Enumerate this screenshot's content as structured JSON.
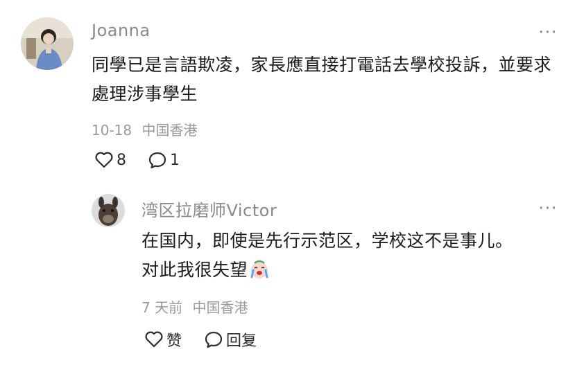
{
  "comments": [
    {
      "username": "Joanna",
      "content": "同學已是言語欺凌，家長應直接打電話去學校投訴，並要求處理涉事學生",
      "date": "10-18",
      "location": "中国香港",
      "like_count": "8",
      "reply_count": "1",
      "more_label": "···",
      "avatar_icon": "avatar-photo",
      "reply": {
        "username": "湾区拉磨师Victor",
        "content_line1": "在国内，即使是先行示范区，学校这不是事儿。",
        "content_line2": "对此我很失望",
        "emoji_icon": "crying-face-emoji",
        "date": "7 天前",
        "location": "中国香港",
        "like_label": "赞",
        "reply_label": "回复",
        "more_label": "···",
        "avatar_icon": "animal-avatar"
      }
    }
  ],
  "colors": {
    "text": "#1a1a1a",
    "muted": "#8a8a8a",
    "background": "#ffffff"
  }
}
